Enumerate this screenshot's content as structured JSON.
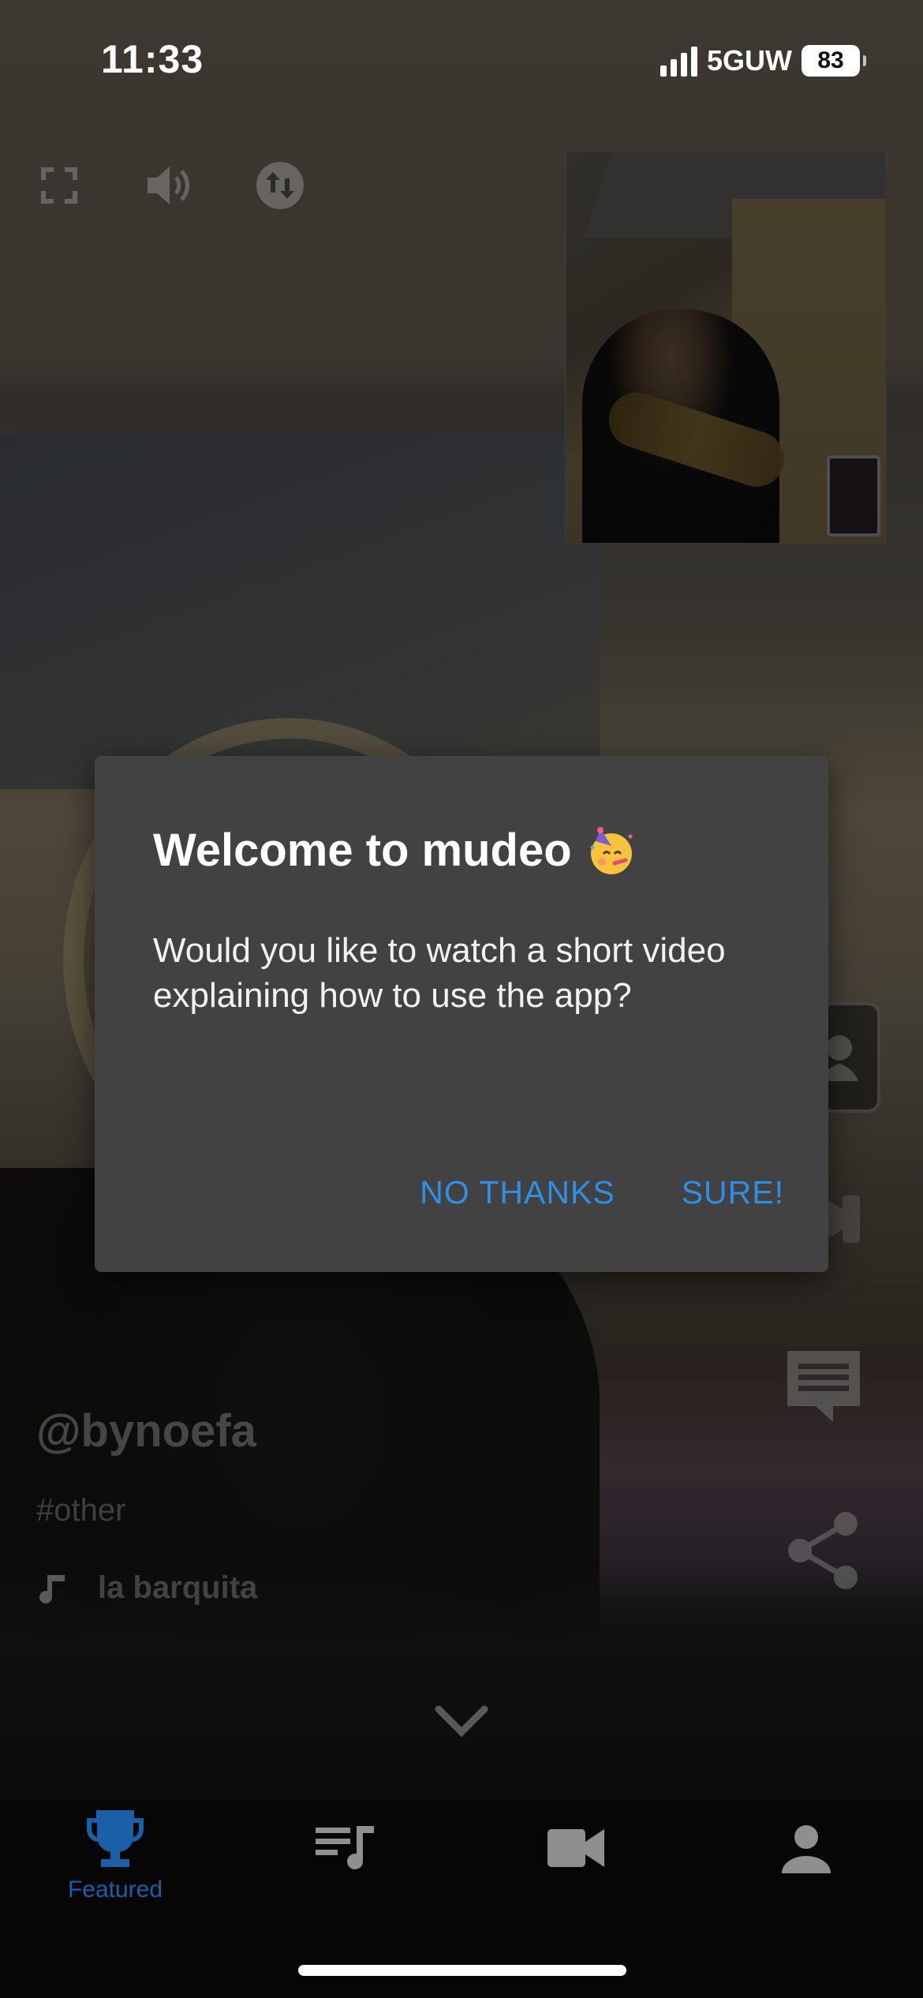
{
  "status_bar": {
    "time": "11:33",
    "network": "5GUW",
    "battery": "83"
  },
  "controls": {
    "fullscreen_icon": "fullscreen-icon",
    "volume_icon": "volume-icon",
    "swap_icon": "swap-vertical-icon"
  },
  "dialog": {
    "title": "Welcome to mudeo",
    "title_emoji": "party-face-icon",
    "body": "Would you like to watch a short video explaining how to use the app?",
    "no_thanks_label": "NO THANKS",
    "sure_label": "SURE!",
    "accent_color": "#2f8fe6"
  },
  "video": {
    "author": "@bynoefa",
    "hashtag": "#other",
    "song": "la barquita"
  },
  "side_actions": [
    "profile-icon",
    "video-camera-icon",
    "comment-icon",
    "share-icon"
  ],
  "bottom_nav": {
    "items": [
      {
        "label": "Featured",
        "icon": "trophy-icon",
        "active": true
      },
      {
        "label": "",
        "icon": "playlist-music-icon",
        "active": false
      },
      {
        "label": "",
        "icon": "video-camera-icon",
        "active": false
      },
      {
        "label": "",
        "icon": "person-icon",
        "active": false
      }
    ],
    "active_color": "#1a5fa8"
  }
}
